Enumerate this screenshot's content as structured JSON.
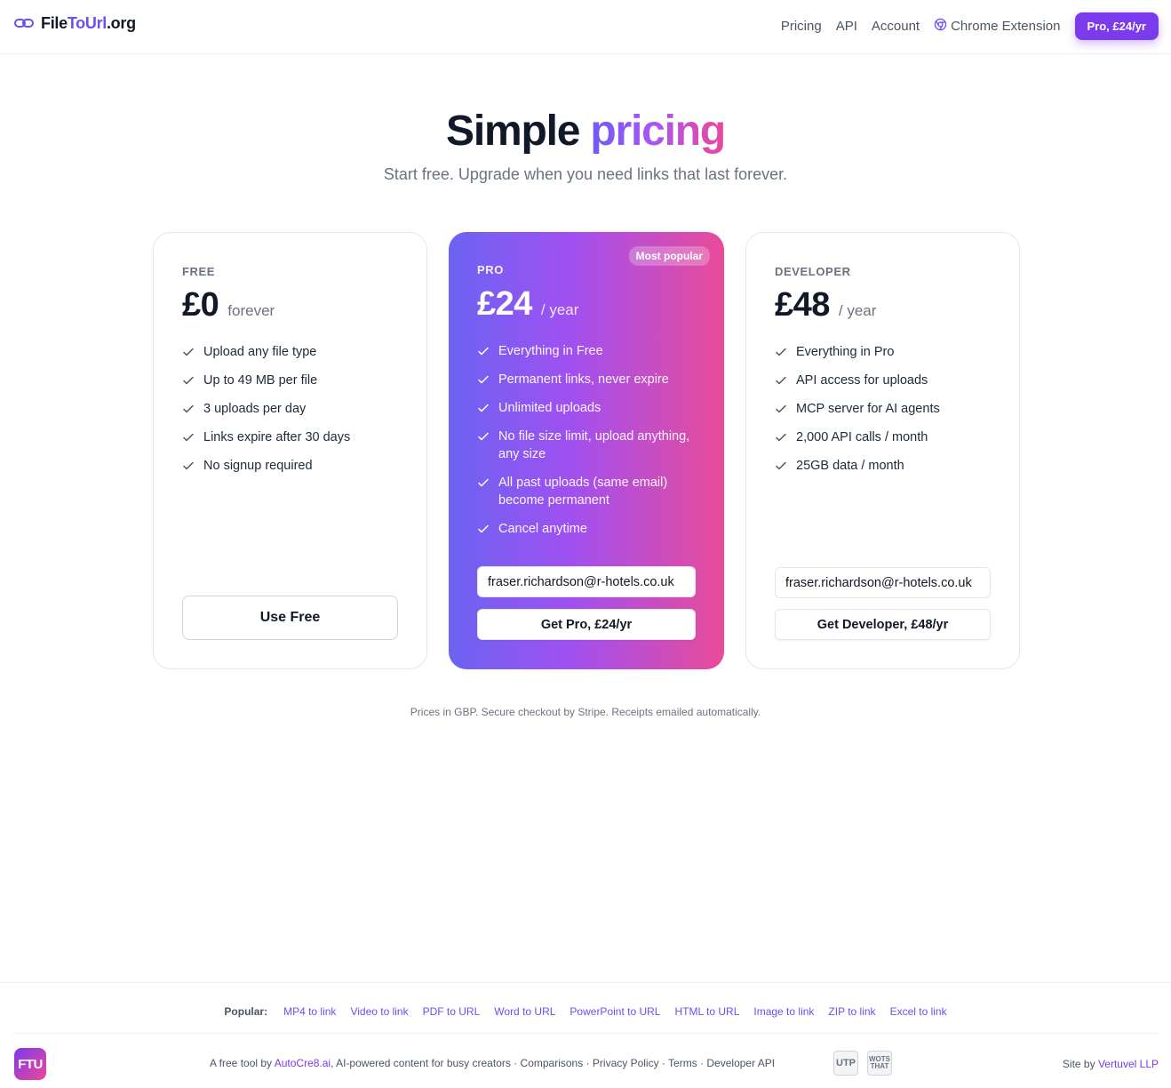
{
  "header": {
    "logo_part1": "File",
    "logo_part2": "ToUrl",
    "logo_part3": ".org",
    "nav": {
      "pricing": "Pricing",
      "api": "API",
      "account": "Account",
      "chrome_extension": "Chrome Extension",
      "cta": "Pro, £24/yr"
    }
  },
  "hero": {
    "title_plain": "Simple",
    "title_accent": "pricing",
    "subtitle": "Start free. Upgrade when you need links that last forever."
  },
  "plans": {
    "free": {
      "tier": "FREE",
      "price": "£0",
      "period": "forever",
      "features": [
        "Upload any file type",
        "Up to 49 MB per file",
        "3 uploads per day",
        "Links expire after 30 days",
        "No signup required"
      ],
      "button": "Use Free"
    },
    "pro": {
      "tier": "PRO",
      "badge": "Most popular",
      "price": "£24",
      "period": "/ year",
      "features": [
        "Everything in Free",
        "Permanent links, never expire",
        "Unlimited uploads",
        "No file size limit, upload anything, any size",
        "All past uploads (same email) become permanent",
        "Cancel anytime"
      ],
      "email": "fraser.richardson@r-hotels.co.uk",
      "button": "Get Pro, £24/yr"
    },
    "developer": {
      "tier": "DEVELOPER",
      "price": "£48",
      "period": "/ year",
      "features": [
        "Everything in Pro",
        "API access for uploads",
        "MCP server for AI agents",
        "2,000 API calls / month",
        "25GB data / month"
      ],
      "email": "fraser.richardson@r-hotels.co.uk",
      "button": "Get Developer, £48/yr"
    }
  },
  "note": "Prices in GBP. Secure checkout by Stripe. Receipts emailed automatically.",
  "footer": {
    "popular_label": "Popular:",
    "popular_links": [
      "MP4 to link",
      "Video to link",
      "PDF to URL",
      "Word to URL",
      "PowerPoint to URL",
      "HTML to URL",
      "Image to link",
      "ZIP to link",
      "Excel to link"
    ],
    "logo_text": "FTU",
    "tool_prefix": "A free tool by ",
    "tool_brand": "AutoCre8.ai",
    "tool_suffix": ", AI-powered content for busy creators · ",
    "comparisons": "Comparisons",
    "privacy": "Privacy Policy",
    "terms": "Terms",
    "developer_api": "Developer API",
    "sep": " · ",
    "partner_1": "UTP",
    "partner_2": "WOTS THAT",
    "site_by_prefix": "Site by ",
    "site_by_brand": "Vertuvel LLP"
  },
  "colors": {
    "accent": "#7c3aed",
    "link": "#6d4ff0",
    "pro_gradient_start": "#6c63f3",
    "pro_gradient_end": "#e94b9a"
  },
  "icons": {
    "logo": "link-icon",
    "chrome": "chrome-icon",
    "feature": "check-icon"
  }
}
